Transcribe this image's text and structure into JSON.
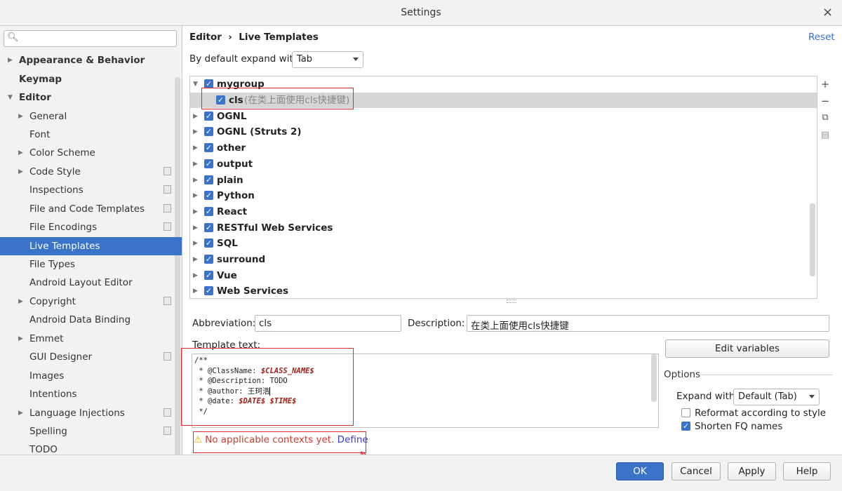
{
  "window": {
    "title": "Settings",
    "close_glyph": "×"
  },
  "search": {
    "placeholder": ""
  },
  "sidebar": {
    "items": [
      {
        "label": "Appearance & Behavior"
      },
      {
        "label": "Keymap"
      },
      {
        "label": "Editor"
      },
      {
        "label": "General"
      },
      {
        "label": "Font"
      },
      {
        "label": "Color Scheme"
      },
      {
        "label": "Code Style"
      },
      {
        "label": "Inspections"
      },
      {
        "label": "File and Code Templates"
      },
      {
        "label": "File Encodings"
      },
      {
        "label": "Live Templates"
      },
      {
        "label": "File Types"
      },
      {
        "label": "Android Layout Editor"
      },
      {
        "label": "Copyright"
      },
      {
        "label": "Android Data Binding"
      },
      {
        "label": "Emmet"
      },
      {
        "label": "GUI Designer"
      },
      {
        "label": "Images"
      },
      {
        "label": "Intentions"
      },
      {
        "label": "Language Injections"
      },
      {
        "label": "Spelling"
      },
      {
        "label": "TODO"
      }
    ]
  },
  "header": {
    "breadcrumb": "Editor  ›  Live Templates",
    "reset": "Reset"
  },
  "expand": {
    "label": "By default expand with",
    "value": "Tab"
  },
  "tree": {
    "groups": [
      {
        "name": "mygroup"
      },
      {
        "name": "cls",
        "desc": "(在类上面使用cls快捷键)"
      },
      {
        "name": "OGNL"
      },
      {
        "name": "OGNL (Struts 2)"
      },
      {
        "name": "other"
      },
      {
        "name": "output"
      },
      {
        "name": "plain"
      },
      {
        "name": "Python"
      },
      {
        "name": "React"
      },
      {
        "name": "RESTful Web Services"
      },
      {
        "name": "SQL"
      },
      {
        "name": "surround"
      },
      {
        "name": "Vue"
      },
      {
        "name": "Web Services"
      }
    ]
  },
  "tools": {
    "add": "+",
    "remove": "−",
    "copy": "⧉",
    "restore": "▤"
  },
  "abbreviation": {
    "label": "Abbreviation:",
    "value": "cls"
  },
  "description": {
    "label": "Description:",
    "value": "在类上面使用cls快捷键"
  },
  "template": {
    "label": "Template text:",
    "lines": [
      {
        "text": "/**"
      },
      {
        "text": " * @ClassName: ",
        "var": "$CLASS_NAME$"
      },
      {
        "text": " * @Description: TODO"
      },
      {
        "text": " * @author: 王珂浩"
      },
      {
        "text": " * @date: ",
        "var": "$DATE$ $TIME$"
      },
      {
        "text": " */"
      }
    ]
  },
  "edit_variables": "Edit variables",
  "options": {
    "label": "Options",
    "expand_label": "Expand with",
    "expand_value": "Default (Tab)",
    "reformat": "Reformat according to style",
    "shorten": "Shorten FQ names"
  },
  "warning": {
    "text": "No applicable contexts yet.",
    "link": "Define"
  },
  "buttons": {
    "ok": "OK",
    "cancel": "Cancel",
    "apply": "Apply",
    "help": "Help"
  }
}
